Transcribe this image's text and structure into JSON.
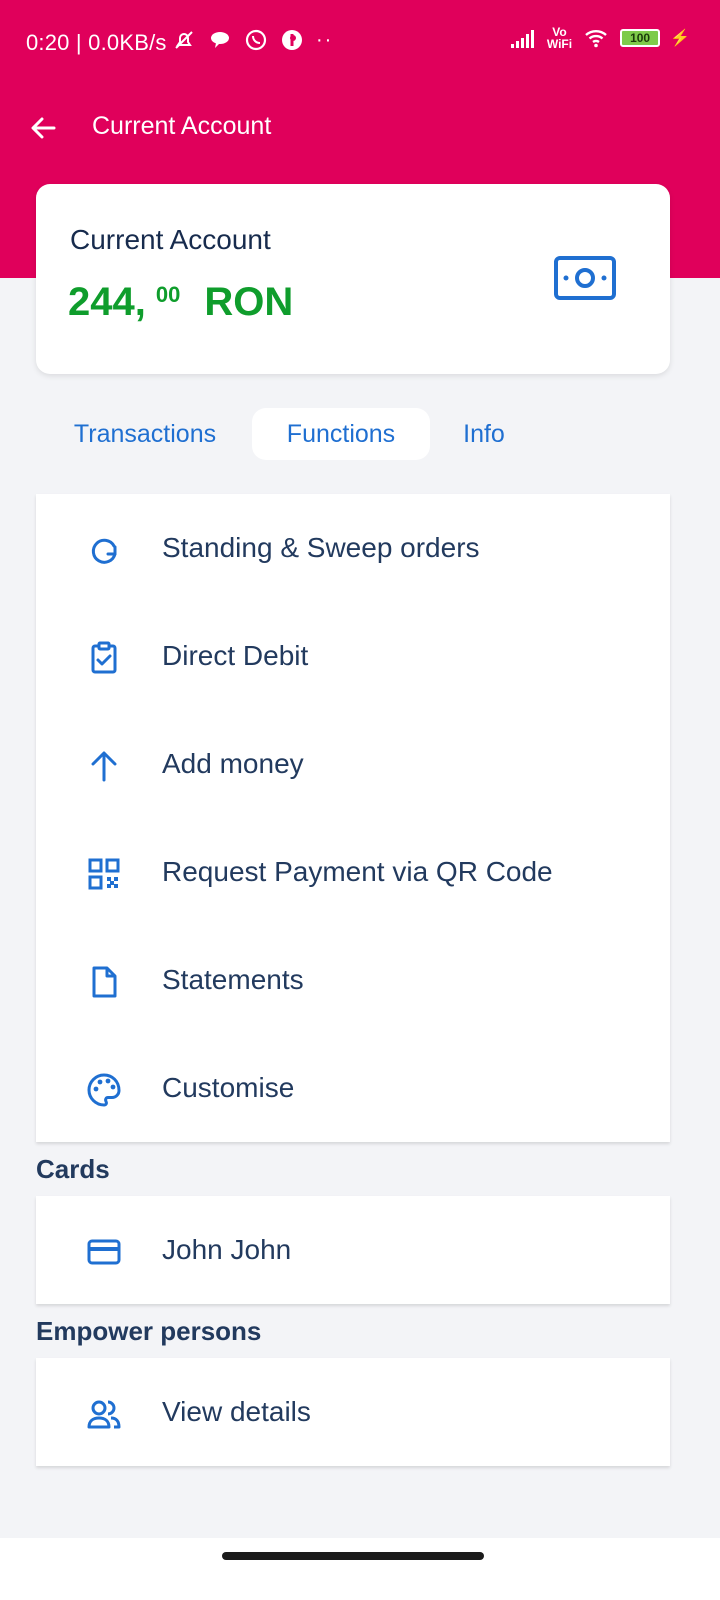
{
  "status_bar": {
    "time": "0:20",
    "speed": "0.0KB/s",
    "dots": "··",
    "vowifi_top": "Vo",
    "vowifi_bottom": "WiFi",
    "battery": "100"
  },
  "header": {
    "title": "Current Account"
  },
  "account": {
    "name": "Current Account",
    "balance_int": "244,",
    "balance_dec": "00",
    "currency": "RON"
  },
  "tabs": [
    {
      "label": "Transactions"
    },
    {
      "label": "Functions"
    },
    {
      "label": "Info"
    }
  ],
  "functions": [
    {
      "label": "Standing & Sweep orders",
      "icon": "refresh-icon"
    },
    {
      "label": "Direct Debit",
      "icon": "clipboard-check-icon"
    },
    {
      "label": "Add money",
      "icon": "arrow-up-icon"
    },
    {
      "label": "Request Payment via QR Code",
      "icon": "qr-code-icon"
    },
    {
      "label": "Statements",
      "icon": "document-icon"
    },
    {
      "label": "Customise",
      "icon": "palette-icon"
    }
  ],
  "cards": {
    "title": "Cards",
    "item_label": "John John"
  },
  "empower": {
    "title": "Empower persons",
    "item_label": "View details"
  },
  "colors": {
    "brand": "#e0005b",
    "accent": "#1f6fd1",
    "balance": "#0f9d2c",
    "text": "#223a5e"
  }
}
